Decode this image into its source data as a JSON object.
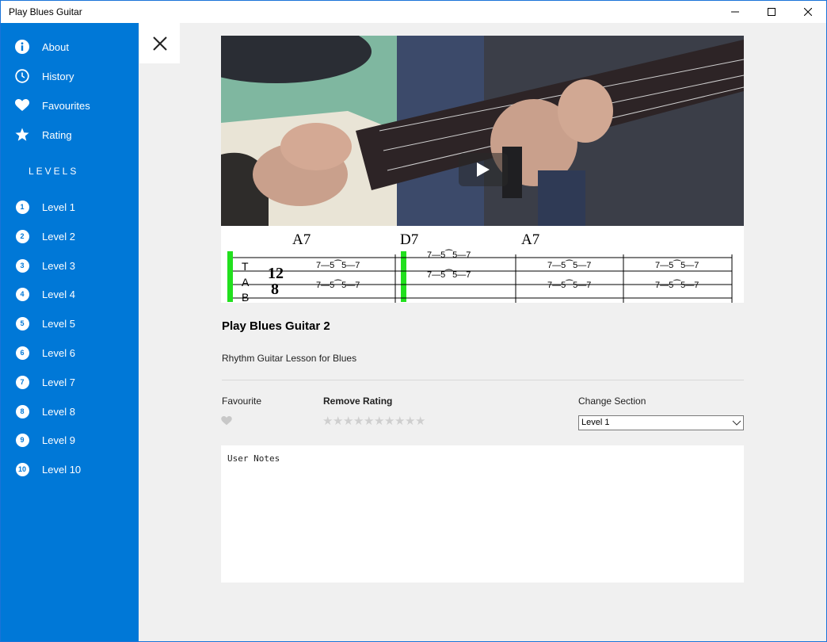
{
  "window": {
    "title": "Play Blues Guitar"
  },
  "sidebar": {
    "items": [
      {
        "label": "About",
        "icon": "info-icon"
      },
      {
        "label": "History",
        "icon": "clock-icon"
      },
      {
        "label": "Favourites",
        "icon": "heart-icon"
      },
      {
        "label": "Rating",
        "icon": "star-icon"
      }
    ],
    "levels_heading": "LEVELS",
    "levels": [
      {
        "num": "1",
        "label": "Level 1"
      },
      {
        "num": "2",
        "label": "Level 2"
      },
      {
        "num": "3",
        "label": "Level 3"
      },
      {
        "num": "4",
        "label": "Level 4"
      },
      {
        "num": "5",
        "label": "Level 5"
      },
      {
        "num": "6",
        "label": "Level 6"
      },
      {
        "num": "7",
        "label": "Level 7"
      },
      {
        "num": "8",
        "label": "Level 8"
      },
      {
        "num": "9",
        "label": "Level 9"
      },
      {
        "num": "10",
        "label": "Level 10"
      }
    ]
  },
  "video": {
    "chords": [
      "A7",
      "D7",
      "A7"
    ],
    "time_signature": "12/8"
  },
  "lesson": {
    "title": "Play Blues Guitar 2",
    "subtitle": "Rhythm Guitar Lesson for Blues"
  },
  "controls": {
    "favourite_label": "Favourite",
    "rating_label": "Remove Rating",
    "rating_value": 0,
    "rating_max": 10,
    "section_label": "Change Section",
    "section_selected": "Level 1"
  },
  "notes": {
    "placeholder": "User Notes"
  },
  "colors": {
    "accent": "#0078d7",
    "tab_highlight": "#22e01e"
  }
}
